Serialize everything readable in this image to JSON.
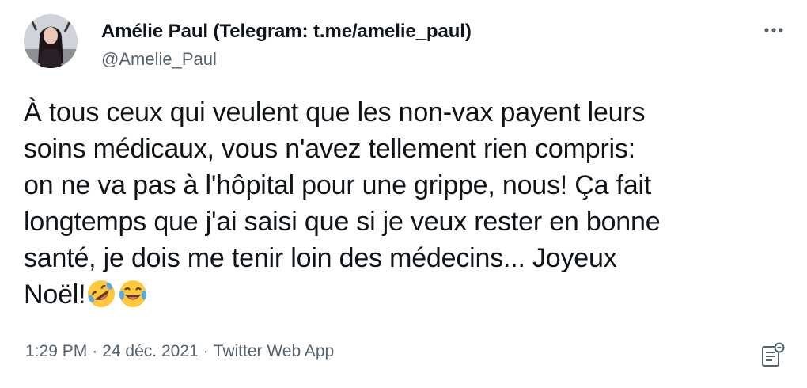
{
  "author": {
    "display_name": "Amélie Paul (Telegram: t.me/amelie_paul)",
    "handle": "@Amelie_Paul"
  },
  "tweet": {
    "text_lines": [
      "À tous ceux qui veulent que les non-vax payent leurs",
      "soins médicaux, vous n'avez tellement rien compris:",
      "on ne va pas à l'hôpital pour une grippe, nous! Ça fait",
      "longtemps que j'ai saisi que si je veux rester en bonne",
      "santé, je dois me tenir loin des médecins... Joyeux",
      "Noël!"
    ],
    "emojis": [
      "rolling-on-floor-laughing-emoji",
      "face-with-tears-of-joy-emoji"
    ]
  },
  "meta": {
    "time": "1:29 PM",
    "separator": "·",
    "date": "24 déc. 2021",
    "source": "Twitter Web App"
  },
  "icons": {
    "more": "more-options-icon",
    "analytics": "tweet-analytics-icon"
  },
  "colors": {
    "text_primary": "#0f1419",
    "text_secondary": "#536471",
    "emoji_yellow": "#ffc83d",
    "emoji_tears": "#5aa9e6"
  }
}
